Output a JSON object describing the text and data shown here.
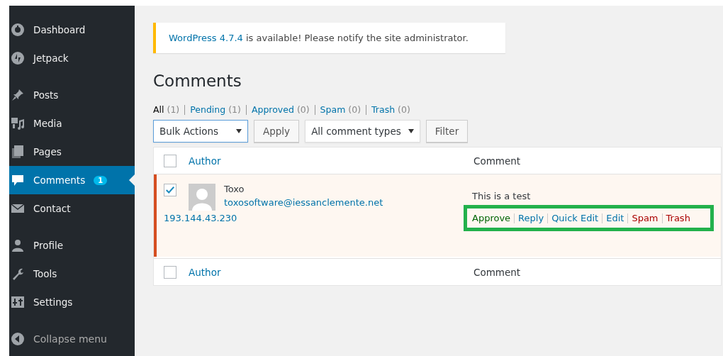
{
  "sidebar": {
    "groups": [
      [
        {
          "label": "Dashboard",
          "selected": false
        },
        {
          "label": "Jetpack",
          "selected": false
        }
      ],
      [
        {
          "label": "Posts",
          "selected": false
        },
        {
          "label": "Media",
          "selected": false
        },
        {
          "label": "Pages",
          "selected": false
        },
        {
          "label": "Comments",
          "selected": true,
          "badge": "1"
        },
        {
          "label": "Contact",
          "selected": false
        }
      ],
      [
        {
          "label": "Profile",
          "selected": false
        },
        {
          "label": "Tools",
          "selected": false
        },
        {
          "label": "Settings",
          "selected": false
        }
      ]
    ],
    "collapse": "Collapse menu"
  },
  "notice": {
    "link": "WordPress 4.7.4",
    "text": " is available! Please notify the site administrator."
  },
  "title": "Comments",
  "filters": [
    {
      "label": "All",
      "count": "(1)",
      "selected": true
    },
    {
      "label": "Pending",
      "count": "(1)",
      "selected": false
    },
    {
      "label": "Approved",
      "count": "(0)",
      "selected": false
    },
    {
      "label": "Spam",
      "count": "(0)",
      "selected": false
    },
    {
      "label": "Trash",
      "count": "(0)",
      "selected": false
    }
  ],
  "bulk_select": "Bulk Actions",
  "apply": "Apply",
  "type_select": "All comment types",
  "filter": "Filter",
  "table": {
    "columns": [
      "Author",
      "Comment"
    ],
    "rows": [
      {
        "checked": true,
        "unapproved": true,
        "author": "Toxo",
        "email": "toxosoftware@iessanclemente.net",
        "ip": "193.144.43.230",
        "comment": "This is a test",
        "highlighted": true,
        "actions": [
          {
            "label": "Approve",
            "kind": "approve"
          },
          {
            "label": "Reply",
            "kind": "normal"
          },
          {
            "label": "Quick Edit",
            "kind": "normal"
          },
          {
            "label": "Edit",
            "kind": "normal"
          },
          {
            "label": "Spam",
            "kind": "danger"
          },
          {
            "label": "Trash",
            "kind": "danger"
          }
        ]
      }
    ],
    "footer_columns": [
      "Author",
      "Comment"
    ],
    "header_checked": false,
    "footer_checked": false
  }
}
